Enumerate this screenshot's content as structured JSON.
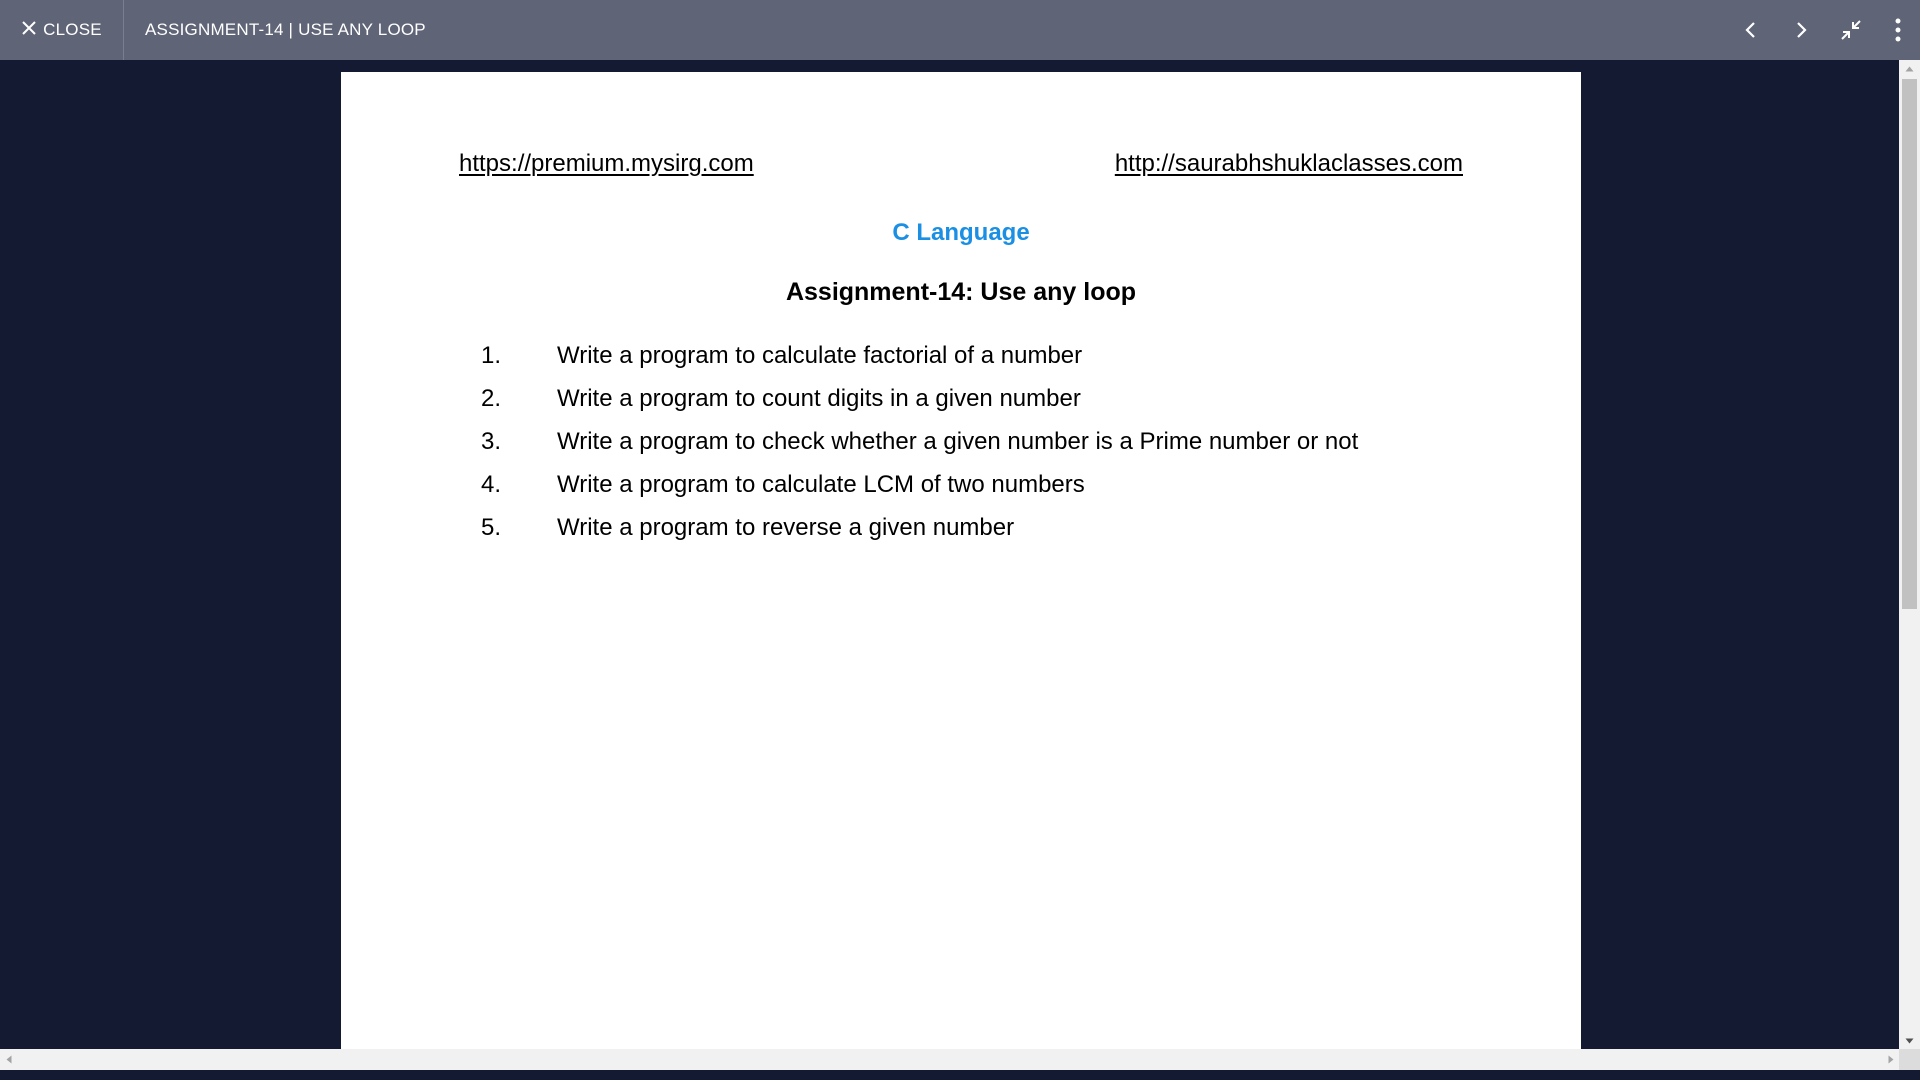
{
  "topbar": {
    "close_label": "CLOSE",
    "title": "ASSIGNMENT-14 | USE ANY LOOP",
    "icons": {
      "close": "close-icon",
      "previous": "chevron-left-icon",
      "next": "chevron-right-icon",
      "exit_fullscreen": "collapse-icon",
      "more": "more-vertical-icon"
    }
  },
  "document": {
    "link_left": "https://premium.mysirg.com",
    "link_right": "http://saurabhshuklaclasses.com",
    "subject": "C Language",
    "title": "Assignment-14: Use any loop",
    "tasks": [
      {
        "num": "1.",
        "text": "Write a program to calculate factorial of a number"
      },
      {
        "num": "2.",
        "text": "Write a program to count digits in a given number"
      },
      {
        "num": "3.",
        "text": "Write a program to check whether a given number is a Prime number or not"
      },
      {
        "num": "4.",
        "text": "Write a program to calculate LCM of two numbers"
      },
      {
        "num": "5.",
        "text": "Write a program to reverse a given number"
      }
    ]
  },
  "colors": {
    "topbar_bg": "#5f6476",
    "viewer_bg": "#141a31",
    "subject_blue": "#1a8fe3"
  }
}
